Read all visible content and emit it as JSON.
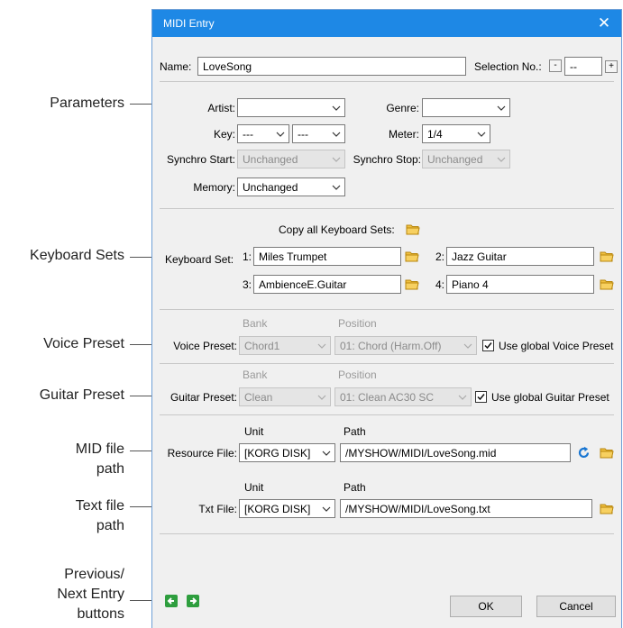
{
  "callouts": {
    "parameters": "Parameters",
    "keyboard_sets": "Keyboard Sets",
    "voice_preset": "Voice Preset",
    "guitar_preset": "Guitar Preset",
    "mid_file": [
      "MID file",
      "path"
    ],
    "text_file": [
      "Text file",
      "path"
    ],
    "prev_next": [
      "Previous/",
      "Next Entry",
      "buttons"
    ]
  },
  "dialog": {
    "title": "MIDI Entry",
    "name_label": "Name:",
    "name_value": "LoveSong",
    "selection_label": "Selection No.:",
    "selection_minus": "-",
    "selection_value": "--",
    "selection_plus": "+"
  },
  "params": {
    "artist_label": "Artist:",
    "artist_value": "",
    "genre_label": "Genre:",
    "genre_value": "",
    "key_label": "Key:",
    "key_value1": "---",
    "key_value2": "---",
    "meter_label": "Meter:",
    "meter_value": "1/4",
    "sync_start_label": "Synchro Start:",
    "sync_start_value": "Unchanged",
    "sync_stop_label": "Synchro Stop:",
    "sync_stop_value": "Unchanged",
    "memory_label": "Memory:",
    "memory_value": "Unchanged"
  },
  "keyboard": {
    "copy_all_label": "Copy all Keyboard Sets:",
    "set_label": "Keyboard Set:",
    "sets": [
      {
        "num": "1:",
        "value": "Miles Trumpet"
      },
      {
        "num": "2:",
        "value": "Jazz Guitar"
      },
      {
        "num": "3:",
        "value": "AmbienceE.Guitar"
      },
      {
        "num": "4:",
        "value": "Piano 4"
      }
    ]
  },
  "voice": {
    "bank_header": "Bank",
    "position_header": "Position",
    "label": "Voice Preset:",
    "bank_value": "Chord1",
    "position_value": "01: Chord (Harm.Off)",
    "global_label": "Use global Voice Preset",
    "global_checked": true
  },
  "guitar": {
    "bank_header": "Bank",
    "position_header": "Position",
    "label": "Guitar Preset:",
    "bank_value": "Clean",
    "position_value": "01: Clean AC30 SC",
    "global_label": "Use global Guitar Preset",
    "global_checked": true
  },
  "files": {
    "unit_header": "Unit",
    "path_header": "Path",
    "resource_label": "Resource File:",
    "resource_unit": "[KORG DISK]",
    "resource_path": "/MYSHOW/MIDI/LoveSong.mid",
    "txt_label": "Txt File:",
    "txt_unit": "[KORG DISK]",
    "txt_path": "/MYSHOW/MIDI/LoveSong.txt"
  },
  "buttons": {
    "ok": "OK",
    "cancel": "Cancel"
  },
  "colors": {
    "titlebar": "#1e88e5",
    "folder": "#f0c040",
    "refresh": "#1976d2",
    "nav": "#2e9e3e"
  }
}
